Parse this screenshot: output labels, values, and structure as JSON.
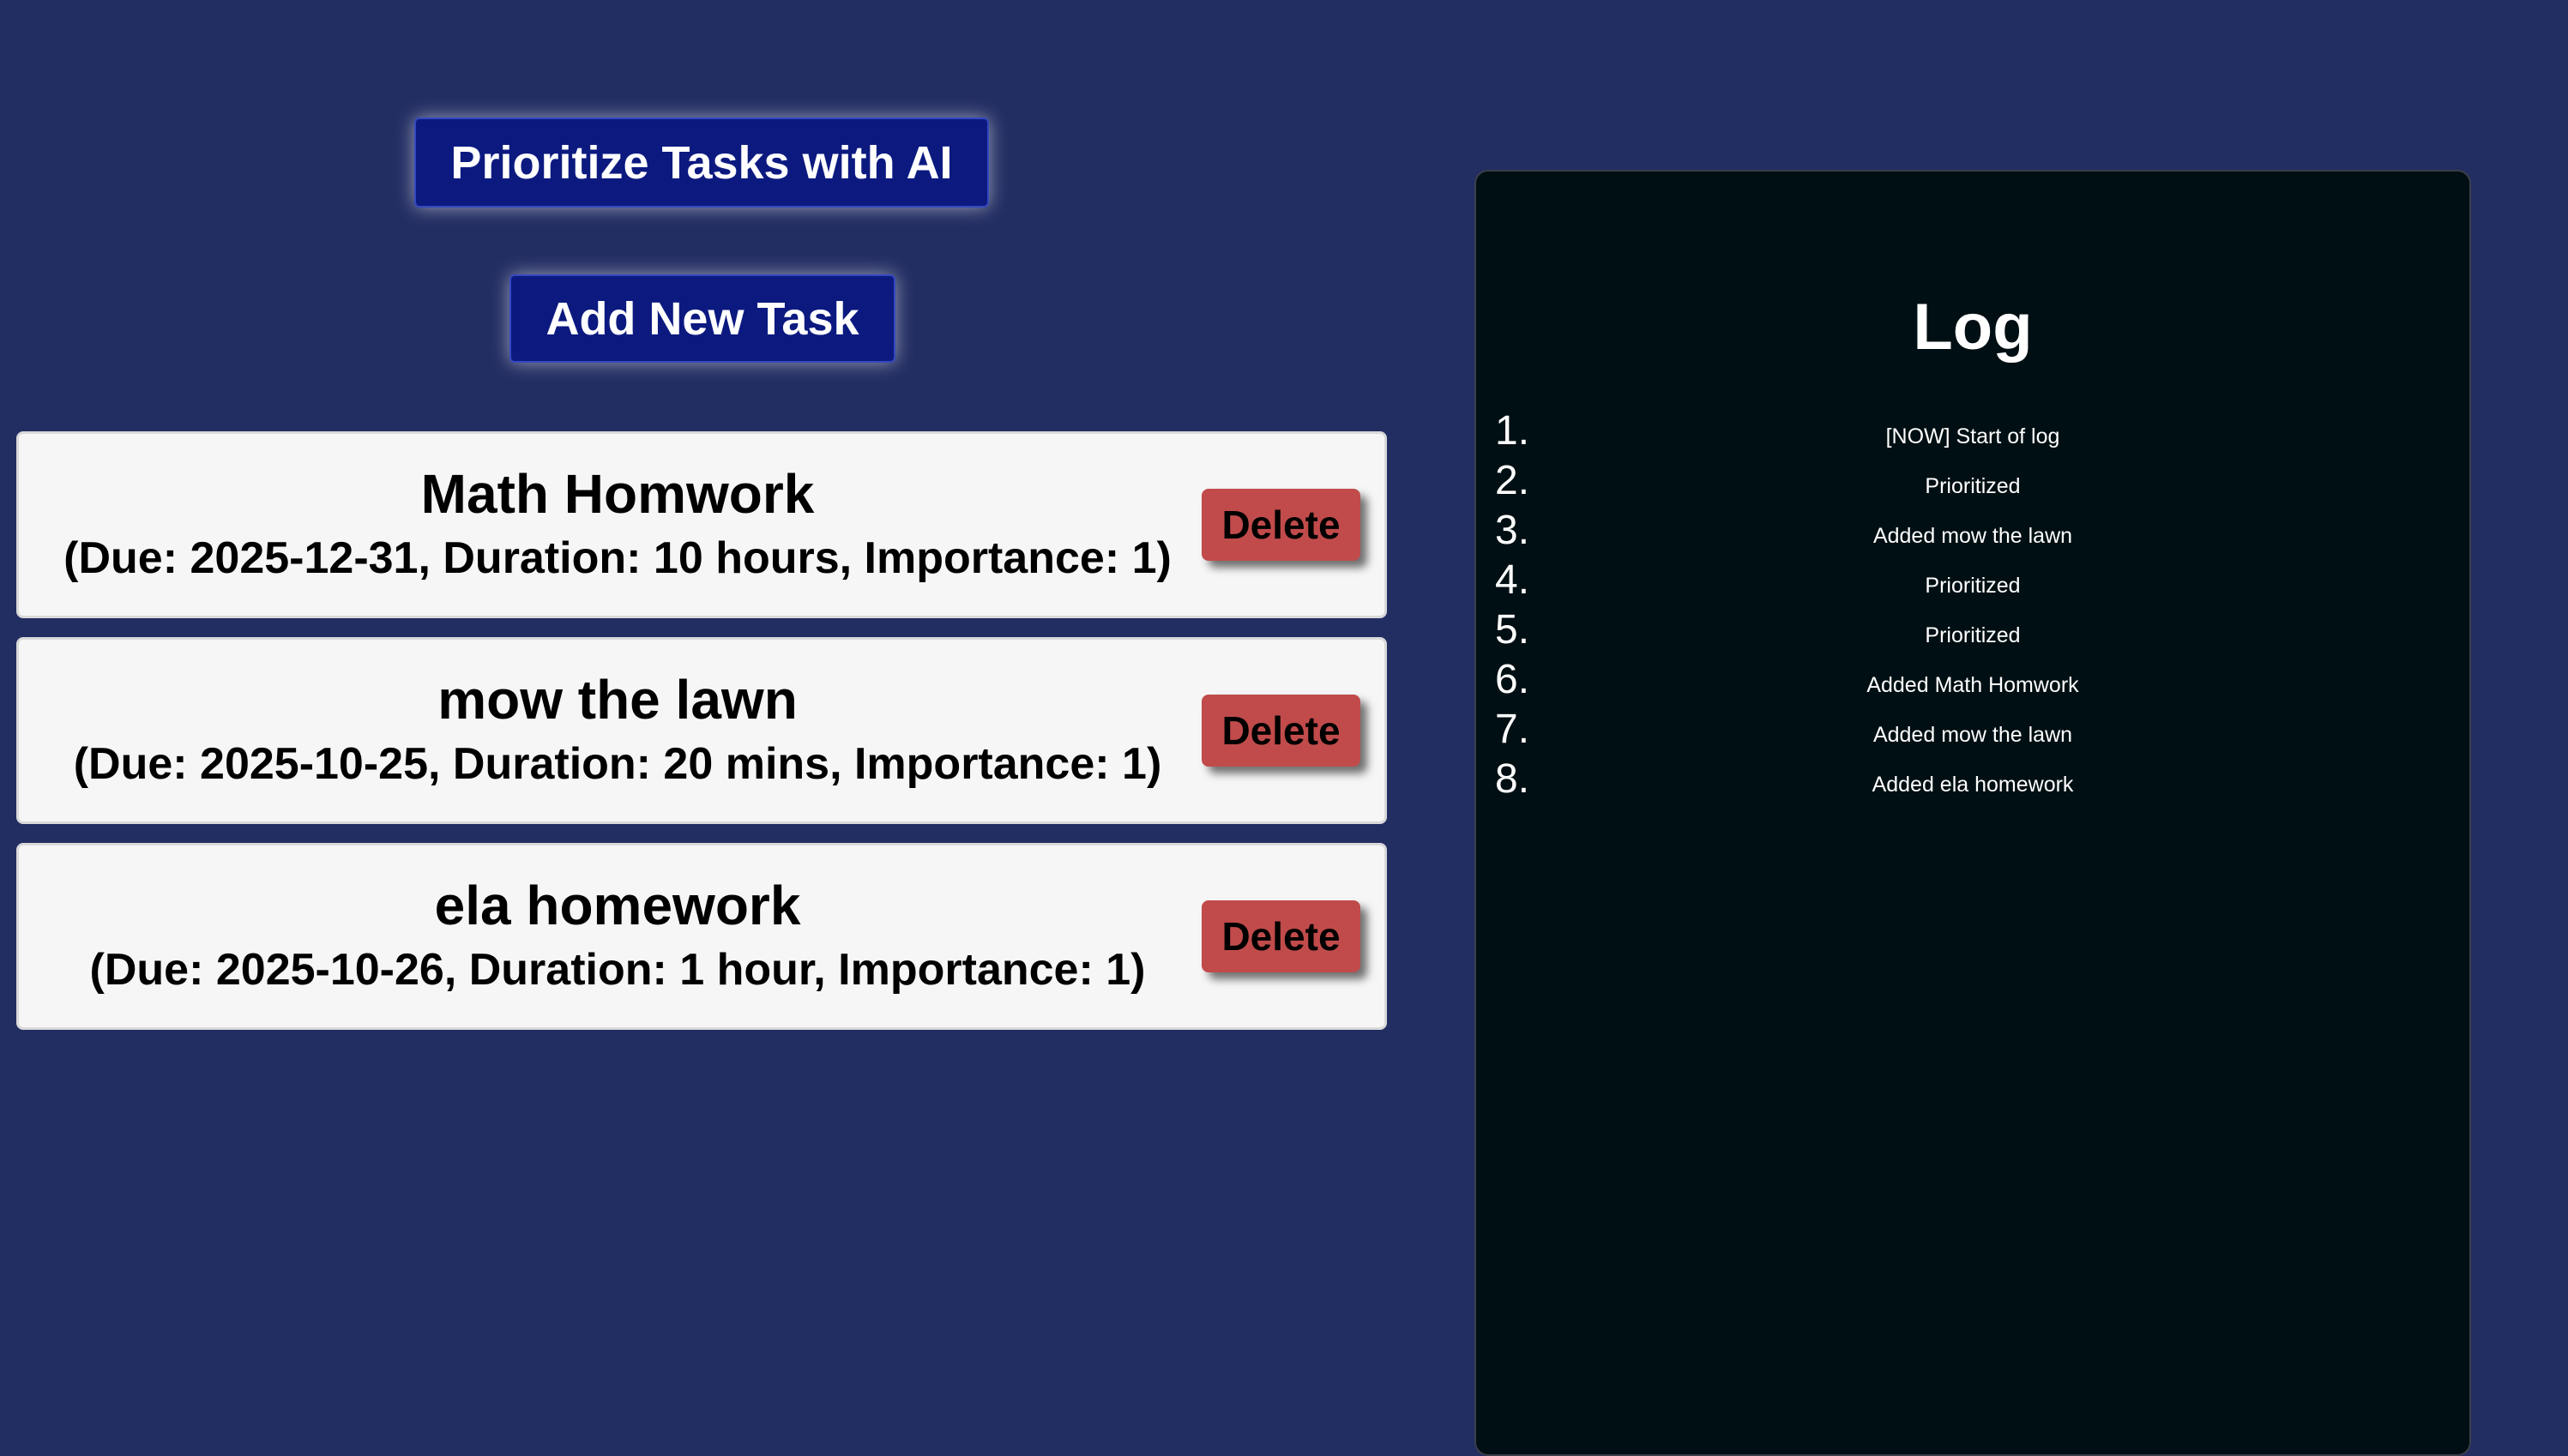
{
  "buttons": {
    "prioritize_label": "Prioritize Tasks with AI",
    "add_task_label": "Add New Task"
  },
  "tasks": [
    {
      "name": "Math Homwork",
      "details": "(Due: 2025-12-31, Duration: 10 hours, Importance: 1)",
      "delete_label": "Delete"
    },
    {
      "name": "mow the lawn",
      "details": "(Due: 2025-10-25, Duration: 20 mins, Importance: 1)",
      "delete_label": "Delete"
    },
    {
      "name": "ela homework",
      "details": "(Due: 2025-10-26, Duration: 1 hour, Importance: 1)",
      "delete_label": "Delete"
    }
  ],
  "log": {
    "title": "Log",
    "entries": [
      {
        "num": "1.",
        "text": "[NOW] Start of log"
      },
      {
        "num": "2.",
        "text": "Prioritized"
      },
      {
        "num": "3.",
        "text": "Added mow the lawn"
      },
      {
        "num": "4.",
        "text": "Prioritized"
      },
      {
        "num": "5.",
        "text": "Prioritized"
      },
      {
        "num": "6.",
        "text": "Added Math Homwork"
      },
      {
        "num": "7.",
        "text": "Added mow the lawn"
      },
      {
        "num": "8.",
        "text": "Added ela homework"
      }
    ]
  },
  "colors": {
    "background": "#222d62",
    "primary_button": "#0c1a80",
    "delete_button": "#c14b4b",
    "card": "#f6f6f6",
    "log_panel": "#000f13"
  }
}
